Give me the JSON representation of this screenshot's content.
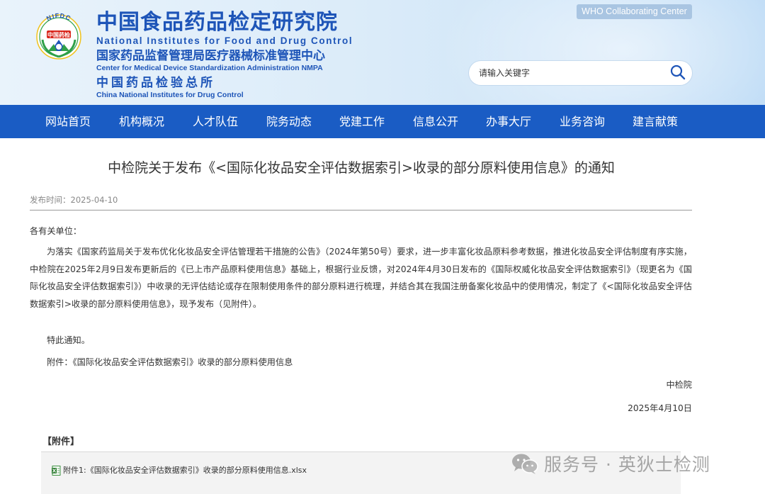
{
  "header": {
    "logo_text_top": "NIFDC",
    "logo_text_center": "中国药检",
    "title_cn": "中国食品药品检定研究院",
    "title_en": "National Institutes for Food and Drug Control",
    "subtitle_cn": "国家药品监督管理局医疗器械标准管理中心",
    "subtitle_en": "Center for Medical Device Standardization Administration NMPA",
    "subtitle2_cn": "中国药品检验总所",
    "subtitle2_en": "China National Institutes for Drug Control",
    "who_badge": "WHO Collaborating Center",
    "search_placeholder": "请输入关键字",
    "icons": {
      "search": "search-icon"
    }
  },
  "nav": {
    "items": [
      "网站首页",
      "机构概况",
      "人才队伍",
      "院务动态",
      "党建工作",
      "信息公开",
      "办事大厅",
      "业务咨询",
      "建言献策"
    ]
  },
  "article": {
    "title": "中检院关于发布《<国际化妆品安全评估数据索引>收录的部分原料使用信息》的通知",
    "publish_label": "发布时间：2025-04-10",
    "salutation": "各有关单位：",
    "paragraph": "为落实《国家药监局关于发布优化化妆品安全评估管理若干措施的公告》（2024年第50号）要求，进一步丰富化妆品原料参考数据，推进化妆品安全评估制度有序实施，中检院在2025年2月9日发布更新后的《已上市产品原料使用信息》基础上，根据行业反馈，对2024年4月30日发布的《国际权威化妆品安全评估数据索引》（现更名为《国际化妆品安全评估数据索引》）中收录的无评估结论或存在限制使用条件的部分原料进行梳理，并结合其在我国注册备案化妆品中的使用情况，制定了《<国际化妆品安全评估数据索引>收录的部分原料使用信息》，现予发布（见附件）。",
    "notice": "特此通知。",
    "attachment_line": "附件：《国际化妆品安全评估数据索引》收录的部分原料使用信息",
    "signature_org": "中检院",
    "signature_date": "2025年4月10日"
  },
  "attachments": {
    "heading": "【附件】",
    "files": [
      {
        "label": "附件1:《国际化妆品安全评估数据索引》收录的部分原料使用信息.xlsx",
        "icon": "excel-file-icon"
      }
    ]
  },
  "watermark": {
    "text": "服务号 · 英狄士检测",
    "icon": "wechat-icon"
  },
  "colors": {
    "nav_bg": "#1a5cc4",
    "title_blue": "#1e55b8",
    "who_badge_bg": "#a9c5e2"
  }
}
